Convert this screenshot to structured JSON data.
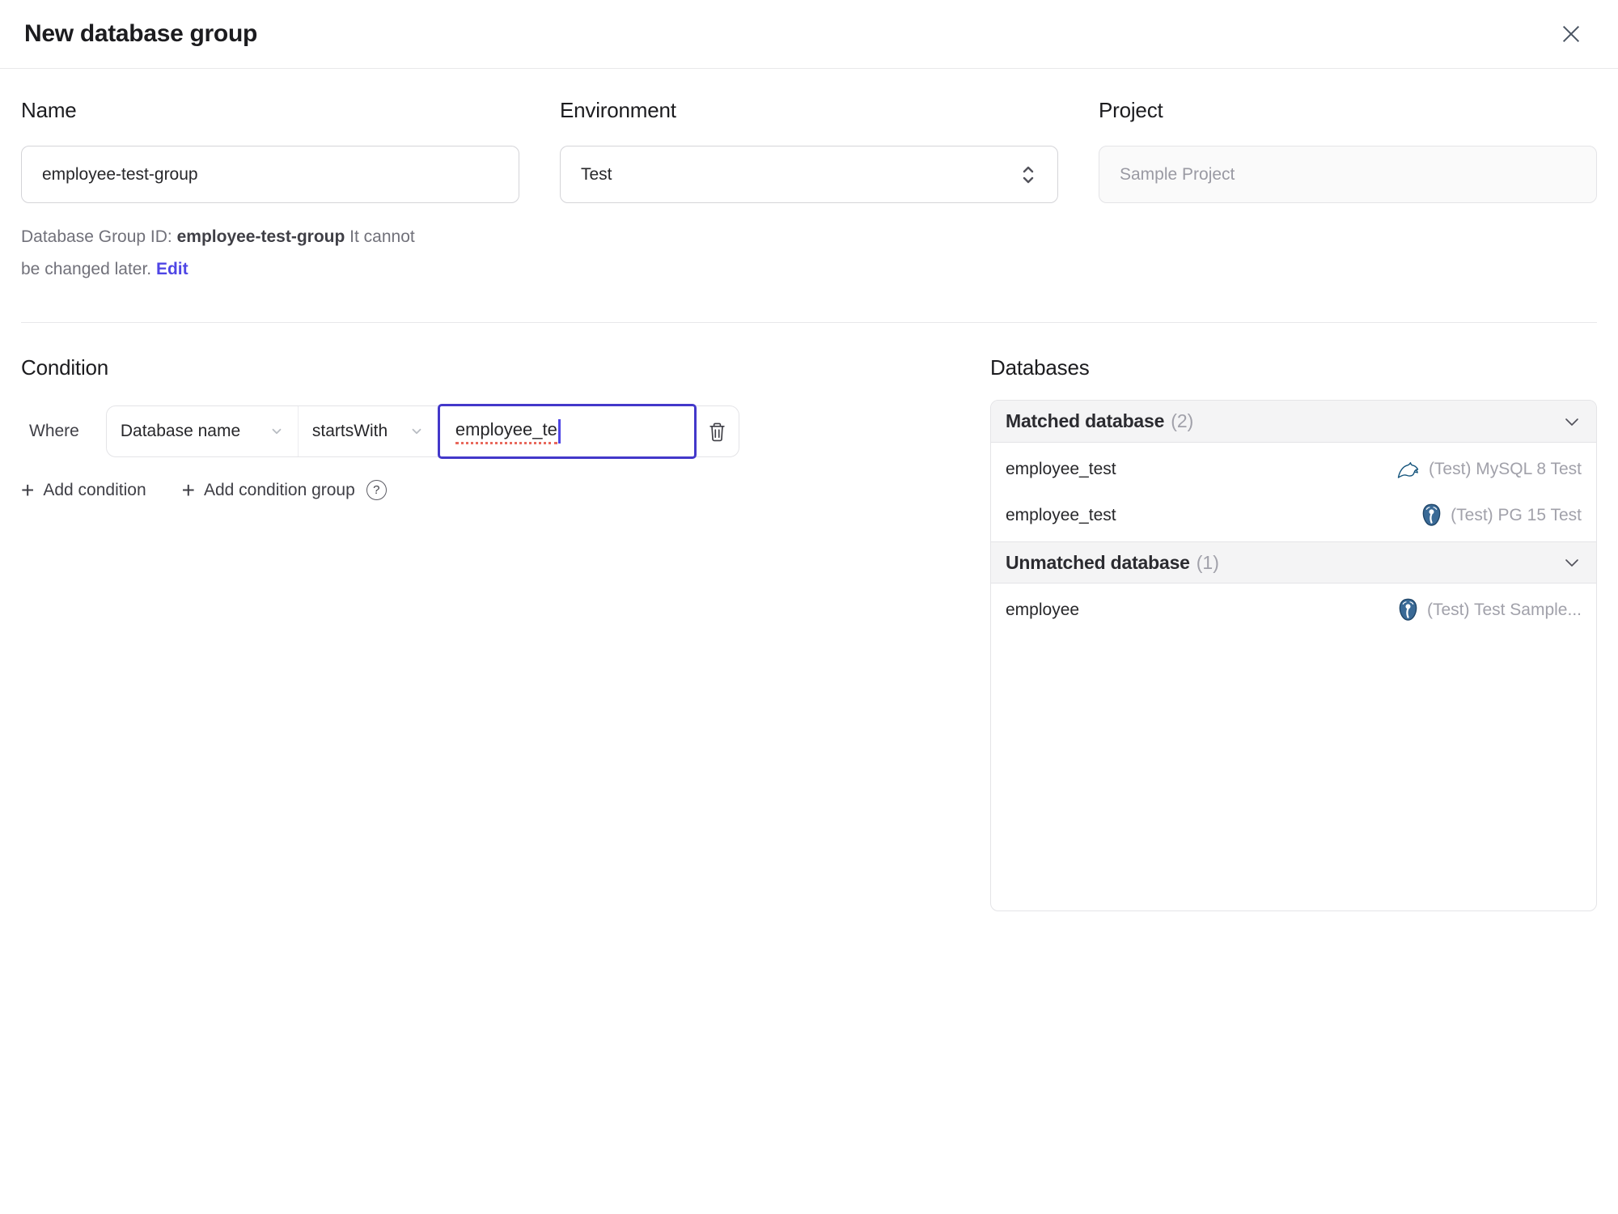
{
  "dialog": {
    "title": "New database group"
  },
  "icons": {
    "plus": "+",
    "help": "?"
  },
  "form": {
    "name": {
      "label": "Name",
      "value": "employee-test-group"
    },
    "environment": {
      "label": "Environment",
      "value": "Test"
    },
    "project": {
      "label": "Project",
      "value": "Sample Project"
    },
    "id_hint": {
      "prefix": "Database Group ID: ",
      "id": "employee-test-group",
      "suffix": " It cannot be changed later. ",
      "edit_link": "Edit"
    }
  },
  "condition": {
    "heading": "Condition",
    "where_label": "Where",
    "field": "Database name",
    "operator": "startsWith",
    "value": "employee_te",
    "add_condition_label": "Add condition",
    "add_condition_group_label": "Add condition group"
  },
  "databases": {
    "heading": "Databases",
    "sections": [
      {
        "label": "Matched database",
        "count": "(2)",
        "rows": [
          {
            "name": "employee_test",
            "engine": "mysql",
            "instance": "(Test) MySQL 8 Test"
          },
          {
            "name": "employee_test",
            "engine": "postgres",
            "instance": "(Test) PG 15 Test"
          }
        ]
      },
      {
        "label": "Unmatched database",
        "count": "(1)",
        "rows": [
          {
            "name": "employee",
            "engine": "postgres",
            "instance": "(Test) Test Sample..."
          }
        ]
      }
    ]
  },
  "colors": {
    "accent": "#4f46e5",
    "focus_border": "#4338ca",
    "spellcheck_underline": "#e8685c",
    "mysql_brand": "#13537b",
    "postgres_brand": "#336791",
    "section_header_bg": "#f4f4f5",
    "border": "#e4e4e7",
    "muted_text": "#a1a1aa"
  }
}
